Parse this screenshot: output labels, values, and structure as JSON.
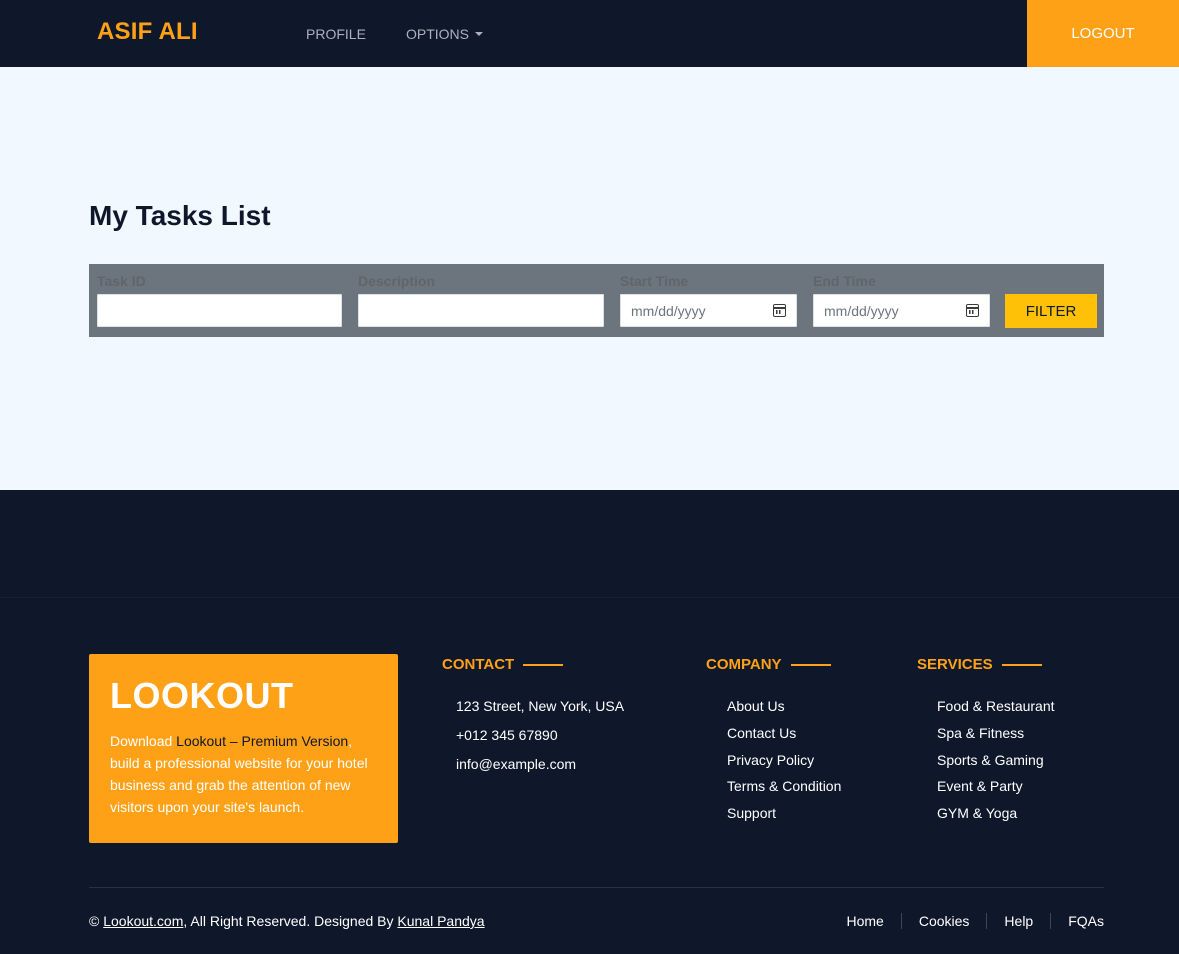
{
  "navbar": {
    "brand": "ASIF ALI",
    "profile_label": "PROFILE",
    "options_label": "OPTIONS",
    "logout_label": "LOGOUT"
  },
  "main": {
    "title": "My Tasks List",
    "filters": {
      "task_id_label": "Task ID",
      "description_label": "Description",
      "start_time_label": "Start Time",
      "start_time_placeholder": "mm/dd/yyyy",
      "end_time_label": "End Time",
      "end_time_placeholder": "mm/dd/yyyy",
      "filter_button": "FILTER"
    }
  },
  "footer": {
    "promo": {
      "title": "LOOKOUT",
      "text_prefix": "Download ",
      "text_highlight": "Lookout – Premium Version",
      "text_suffix": ", build a professional website for your hotel business and grab the attention of new visitors upon your site's launch."
    },
    "contact": {
      "title": "CONTACT",
      "items": [
        "123 Street, New York, USA",
        "+012 345 67890",
        "info@example.com"
      ]
    },
    "company": {
      "title": "COMPANY",
      "items": [
        "About Us",
        "Contact Us",
        "Privacy Policy",
        "Terms & Condition",
        "Support"
      ]
    },
    "services": {
      "title": "SERVICES",
      "items": [
        "Food & Restaurant",
        "Spa & Fitness",
        "Sports & Gaming",
        "Event & Party",
        "GYM & Yoga"
      ]
    },
    "copyright": {
      "symbol": "©",
      "site_link": "Lookout.com",
      "middle_text": ", All Right Reserved. Designed By ",
      "designer_link": "Kunal Pandya"
    },
    "bottom_links": [
      "Home",
      "Cookies",
      "Help",
      "FQAs"
    ]
  },
  "colors": {
    "accent": "#fea116",
    "filter_button": "#fec107",
    "dark_bg": "#0f172b",
    "main_bg": "#f1f8ff",
    "filter_bar": "#6c757d"
  }
}
